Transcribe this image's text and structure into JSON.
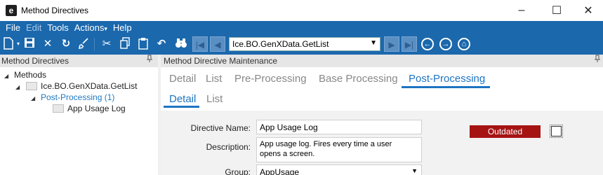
{
  "window": {
    "logo_letter": "e",
    "title": "Method Directives",
    "min_icon": "–",
    "max_icon": "☐",
    "close_icon": "✕"
  },
  "menu": {
    "items": [
      "File",
      "Edit",
      "Tools",
      "Actions",
      "Help"
    ],
    "actions_caret": "▾"
  },
  "toolbar": {
    "search_value": "Ice.BO.GenXData.GetList",
    "dropdown_arrow": "▼",
    "icons": [
      "new-icon",
      "save-icon",
      "delete-icon",
      "refresh-icon",
      "clear-icon",
      "cut-icon",
      "copy-icon",
      "paste-icon",
      "undo-icon",
      "binoculars-icon"
    ]
  },
  "left_panel": {
    "title": "Method Directives",
    "pin_icon": "📌",
    "tree": {
      "root": "Methods",
      "method": "Ice.BO.GenXData.GetList",
      "group": "Post-Processing (1)",
      "leaf": "App Usage Log"
    }
  },
  "right_panel": {
    "title": "Method Directive Maintenance",
    "tabs": [
      "Detail",
      "List",
      "Pre-Processing",
      "Base Processing",
      "Post-Processing"
    ],
    "subtabs": [
      "Detail",
      "List"
    ]
  },
  "form": {
    "directive_name_label": "Directive Name:",
    "directive_name_value": "App Usage Log",
    "description_label": "Description:",
    "description_line1": "App usage log. Fires every time a user",
    "description_line2": "opens a screen.",
    "group_label": "Group:",
    "group_value": "AppUsage",
    "status_badge": "Outdated"
  },
  "colors": {
    "accent": "#1b68ad",
    "tab_active": "#1e74c2",
    "status_outdated": "#a51313"
  }
}
